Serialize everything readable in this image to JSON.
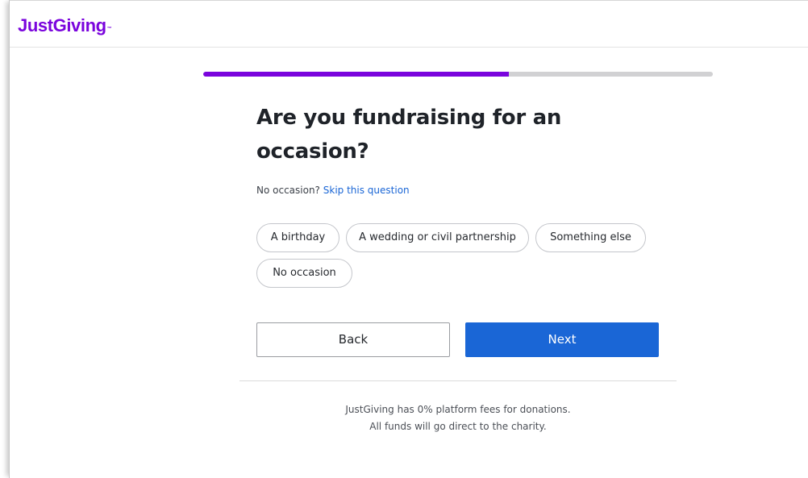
{
  "brand": {
    "name": "JustGiving",
    "trademark": "™",
    "color": "#7a04dd"
  },
  "progress": {
    "fraction": 0.6,
    "fill_color": "#7a04dd",
    "track_color": "#d1d1d3"
  },
  "question": {
    "title": "Are you fundraising for an occasion?",
    "skip_prefix": "No occasion?",
    "skip_link": "Skip this question"
  },
  "options": [
    {
      "label": "A birthday"
    },
    {
      "label": "A wedding or civil partnership"
    },
    {
      "label": "Something else"
    },
    {
      "label": "No occasion"
    }
  ],
  "actions": {
    "back_label": "Back",
    "next_label": "Next",
    "primary_color": "#1a66d6"
  },
  "footer": {
    "line1": "JustGiving has 0% platform fees for donations.",
    "line2": "All funds will go direct to the charity."
  }
}
